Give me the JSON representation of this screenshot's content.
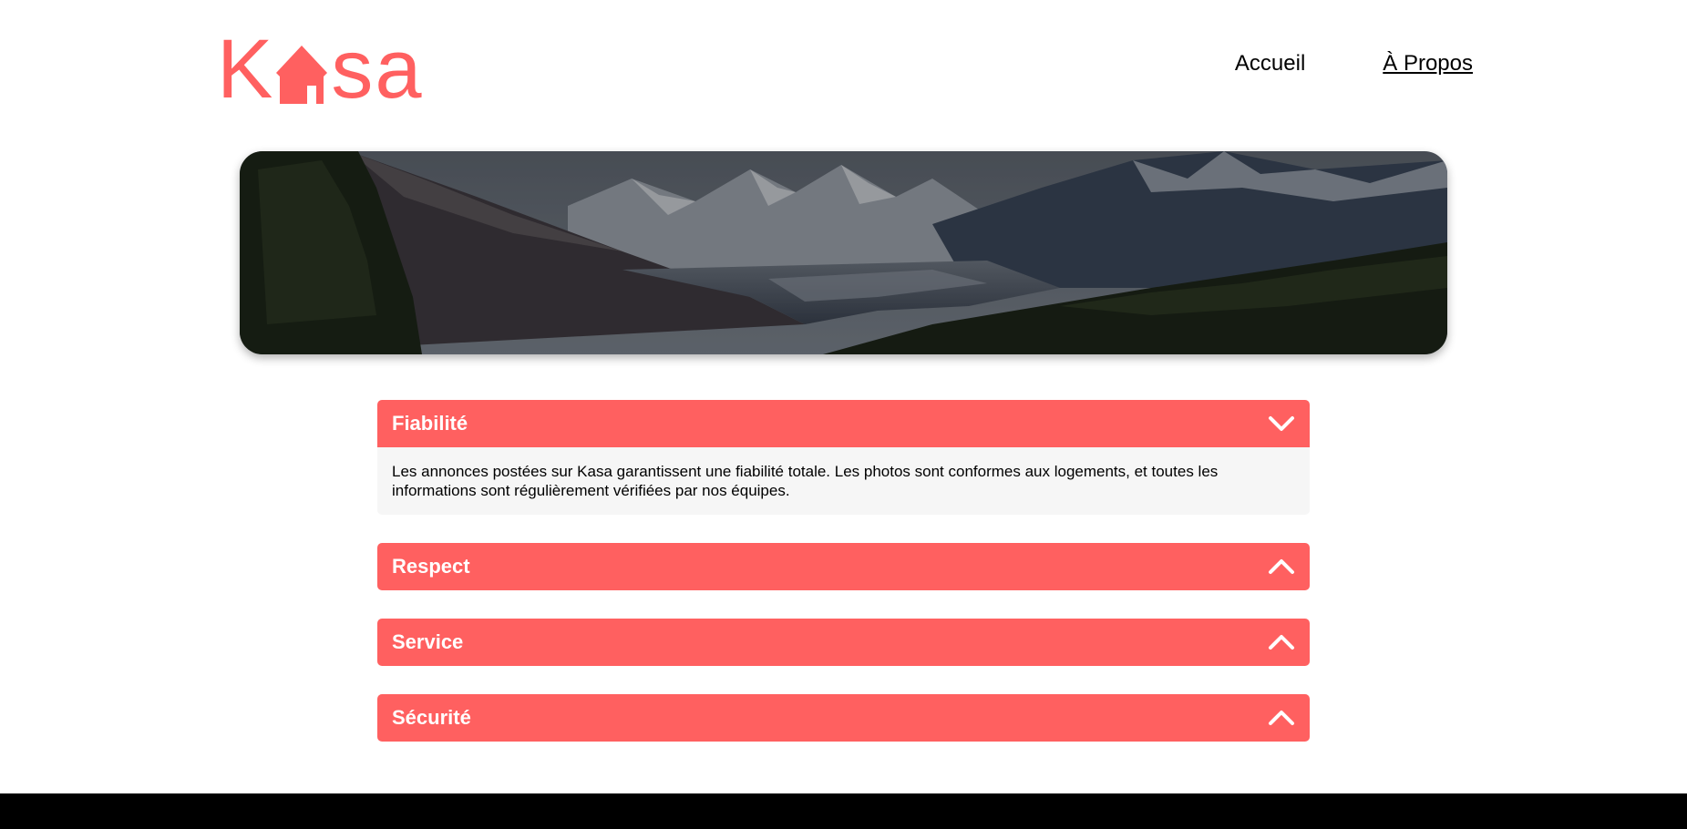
{
  "brand": {
    "logo_text_k": "K",
    "logo_text_rest": "sa",
    "accent_color": "#FF6060"
  },
  "nav": {
    "home_label": "Accueil",
    "about_label": "À Propos"
  },
  "banner": {
    "image": "mountain-valley-landscape"
  },
  "collapses": [
    {
      "title": "Fiabilité",
      "open": true,
      "content": "Les annonces postées sur Kasa garantissent une fiabilité totale. Les photos sont conformes aux logements, et toutes les informations sont régulièrement vérifiées par nos équipes."
    },
    {
      "title": "Respect",
      "open": false
    },
    {
      "title": "Service",
      "open": false
    },
    {
      "title": "Sécurité",
      "open": false
    }
  ]
}
